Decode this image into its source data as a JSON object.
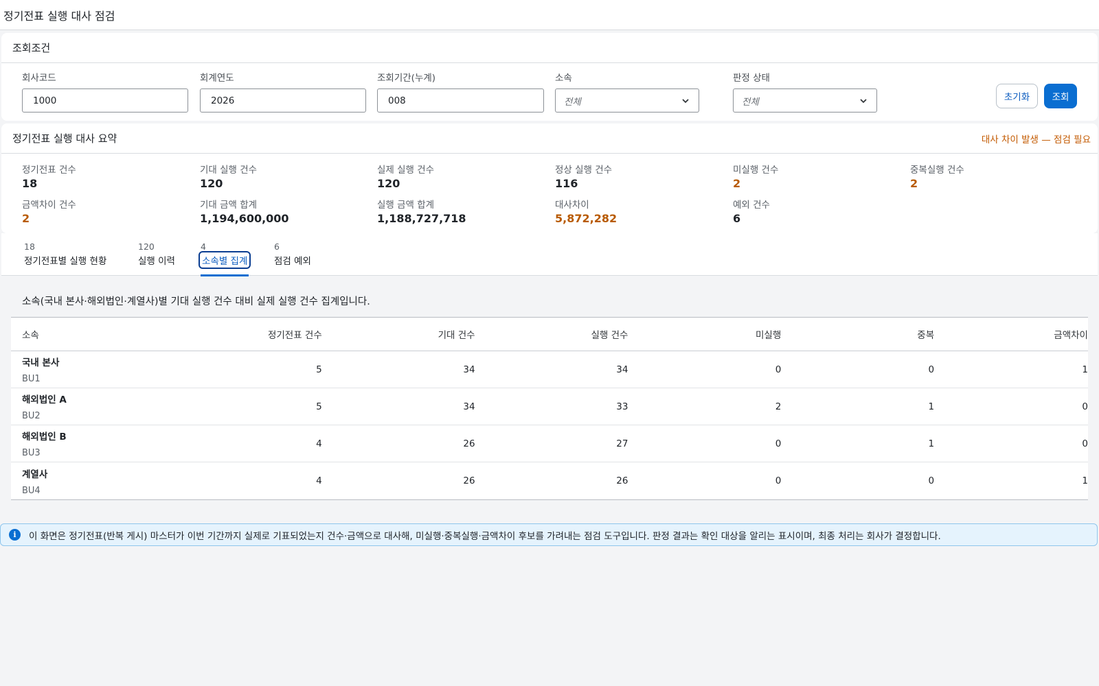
{
  "page": {
    "title": "정기전표 실행 대사 점검"
  },
  "filters": {
    "title": "조회조건",
    "company_code": {
      "label": "회사코드",
      "value": "1000"
    },
    "fiscal_year": {
      "label": "회계연도",
      "value": "2026"
    },
    "period": {
      "label": "조회기간(누계)",
      "value": "008"
    },
    "affiliation": {
      "label": "소속",
      "value": "전체"
    },
    "judgment": {
      "label": "판정 상태",
      "value": "전체"
    },
    "reset_label": "초기화",
    "search_label": "조회"
  },
  "summary": {
    "title": "정기전표 실행 대사 요약",
    "alert": "대사 차이 발생 — 점검 필요",
    "kpis": [
      {
        "label": "정기전표 건수",
        "value": "18"
      },
      {
        "label": "기대 실행 건수",
        "value": "120"
      },
      {
        "label": "실제 실행 건수",
        "value": "120"
      },
      {
        "label": "정상 실행 건수",
        "value": "116"
      },
      {
        "label": "미실행 건수",
        "value": "2"
      },
      {
        "label": "중복실행 건수",
        "value": "2"
      },
      {
        "label": "금액차이 건수",
        "value": "2"
      },
      {
        "label": "기대 금액 합계",
        "value": "1,194,600,000"
      },
      {
        "label": "실행 금액 합계",
        "value": "1,188,727,718"
      },
      {
        "label": "대사차이",
        "value": "5,872,282"
      },
      {
        "label": "예외 건수",
        "value": "6"
      }
    ],
    "warn_color": "#b85a00"
  },
  "tabs": [
    {
      "count": "18",
      "label": "정기전표별 실행 현황"
    },
    {
      "count": "120",
      "label": "실행 이력"
    },
    {
      "count": "4",
      "label": "소속별 집계"
    },
    {
      "count": "6",
      "label": "점검 예외"
    }
  ],
  "active_tab": 2,
  "table": {
    "description": "소속(국내 본사·해외법인·계열사)별 기대 실행 건수 대비 실제 실행 건수 집계입니다.",
    "columns": [
      "소속",
      "정기전표 건수",
      "기대 건수",
      "실행 건수",
      "미실행",
      "중복",
      "금액차이"
    ],
    "rows": [
      {
        "name": "국내 본사",
        "code": "BU1",
        "vouchers": "5",
        "expected": "34",
        "executed": "34",
        "missing": "0",
        "duplicate": "0",
        "amount_diff": "1"
      },
      {
        "name": "해외법인 A",
        "code": "BU2",
        "vouchers": "5",
        "expected": "34",
        "executed": "33",
        "missing": "2",
        "duplicate": "1",
        "amount_diff": "0"
      },
      {
        "name": "해외법인 B",
        "code": "BU3",
        "vouchers": "4",
        "expected": "26",
        "executed": "27",
        "missing": "0",
        "duplicate": "1",
        "amount_diff": "0"
      },
      {
        "name": "계열사",
        "code": "BU4",
        "vouchers": "4",
        "expected": "26",
        "executed": "26",
        "missing": "0",
        "duplicate": "0",
        "amount_diff": "1"
      }
    ]
  },
  "info": {
    "icon": "info-icon",
    "text": "이 화면은 정기전표(반복 게시) 마스터가 이번 기간까지 실제로 기표되었는지 건수·금액으로 대사해, 미실행·중복실행·금액차이 후보를 가려내는 점검 도구입니다. 판정 결과는 확인 대상을 알리는 표시이며, 최종 처리는 회사가 결정합니다."
  },
  "colors": {
    "accent": "#0a6ed1",
    "warning": "#b85a00",
    "info_bg": "#e5f3fd"
  }
}
